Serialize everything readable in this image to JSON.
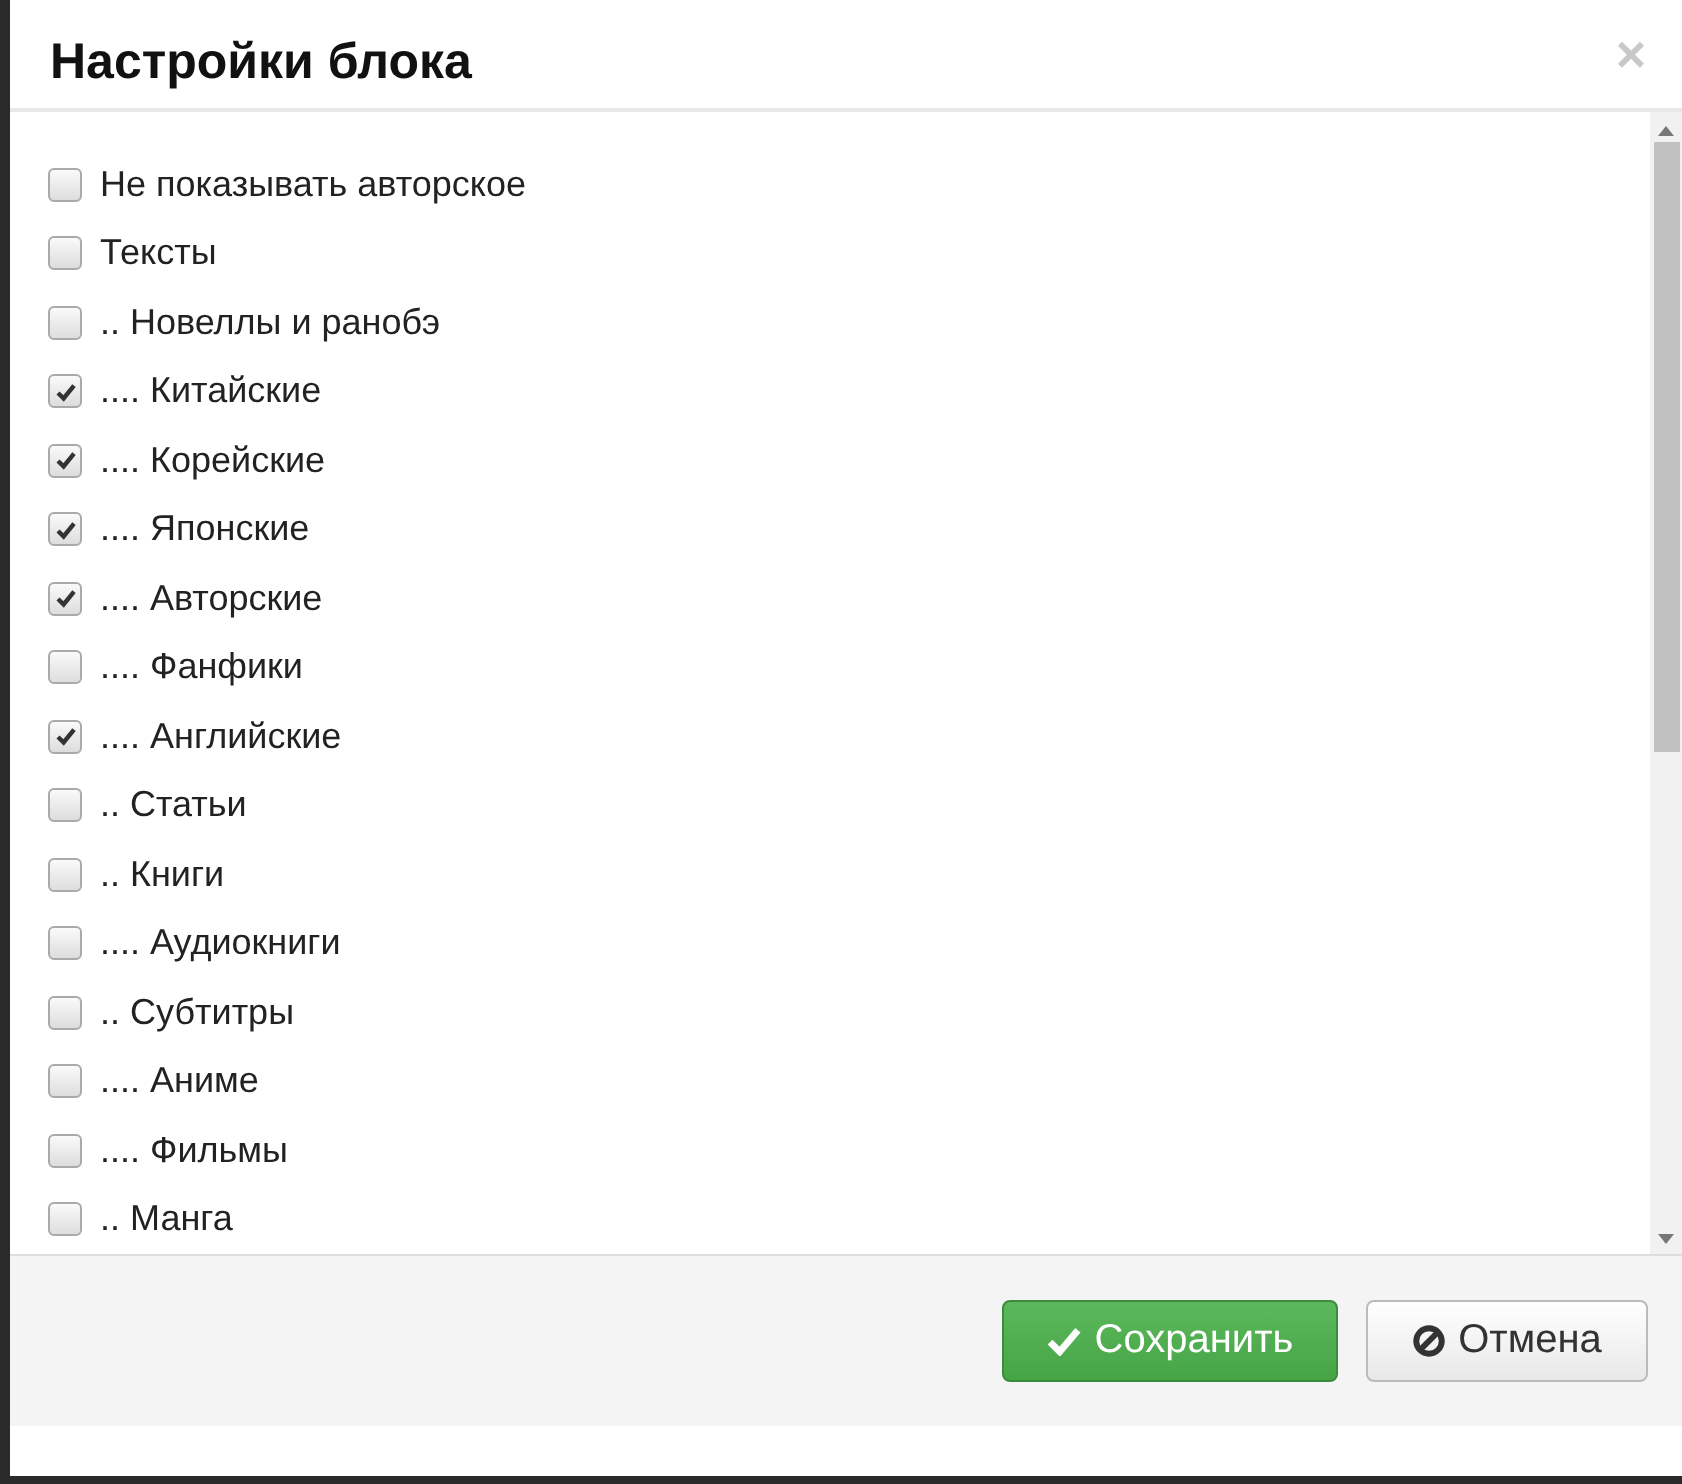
{
  "dialog": {
    "title": "Настройки блока",
    "close": "×"
  },
  "options": [
    {
      "label": "Не показывать авторское",
      "checked": false
    },
    {
      "label": "Тексты",
      "checked": false
    },
    {
      "label": ".. Новеллы и ранобэ",
      "checked": false
    },
    {
      "label": ".... Китайские",
      "checked": true
    },
    {
      "label": ".... Корейские",
      "checked": true
    },
    {
      "label": ".... Японские",
      "checked": true
    },
    {
      "label": ".... Авторские",
      "checked": true
    },
    {
      "label": ".... Фанфики",
      "checked": false
    },
    {
      "label": ".... Английские",
      "checked": true
    },
    {
      "label": ".. Статьи",
      "checked": false
    },
    {
      "label": ".. Книги",
      "checked": false
    },
    {
      "label": ".... Аудиокниги",
      "checked": false
    },
    {
      "label": ".. Субтитры",
      "checked": false
    },
    {
      "label": ".... Аниме",
      "checked": false
    },
    {
      "label": ".... Фильмы",
      "checked": false
    },
    {
      "label": ".. Манга",
      "checked": false
    }
  ],
  "buttons": [
    {
      "kind": "save",
      "label": "Сохранить"
    },
    {
      "kind": "cancel",
      "label": "Отмена"
    }
  ]
}
